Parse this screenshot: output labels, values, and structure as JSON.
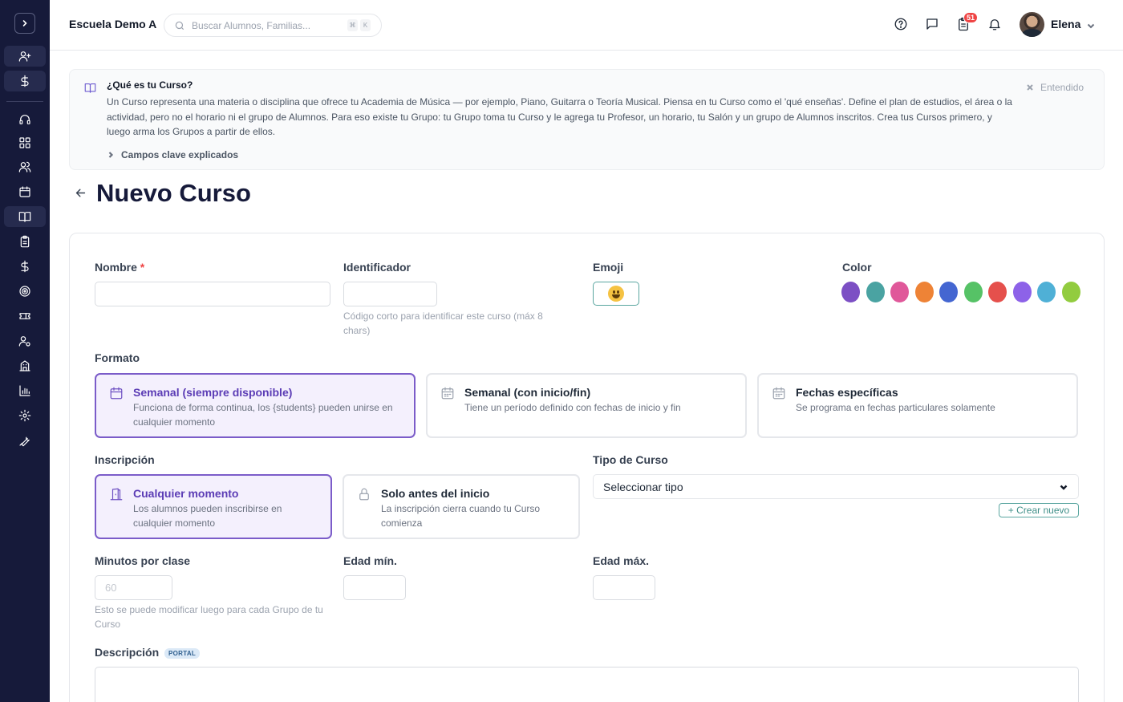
{
  "topbar": {
    "school_name": "Escuela Demo A",
    "search_placeholder": "Buscar Alumnos, Familias...",
    "shortcut_keys": [
      "⌘",
      "K"
    ],
    "notifications_badge": "51",
    "user_name": "Elena"
  },
  "sidebar": {
    "icons": [
      "user-plus-icon",
      "dollar-icon",
      "headset-icon",
      "grid-icon",
      "users-icon",
      "calendar-icon",
      "book-icon",
      "clipboard-icon",
      "dollar-icon",
      "target-icon",
      "ticket-icon",
      "user-gear-icon",
      "building-icon",
      "chart-icon",
      "gear-icon",
      "wrench-icon"
    ]
  },
  "banner": {
    "title": "¿Qué es tu Curso?",
    "text": "Un Curso representa una materia o disciplina que ofrece tu Academia de Música — por ejemplo, Piano, Guitarra o Teoría Musical. Piensa en tu Curso como el 'qué enseñas'. Define el plan de estudios, el área o la actividad, pero no el horario ni el grupo de Alumnos. Para eso existe tu Grupo: tu Grupo toma tu Curso y le agrega tu Profesor, un horario, tu Salón y un grupo de Alumnos inscritos. Crea tus Cursos primero, y luego arma los Grupos a partir de ellos.",
    "expand_label": "Campos clave explicados",
    "dismiss_label": "Entendido"
  },
  "page": {
    "title": "Nuevo Curso"
  },
  "form": {
    "name": {
      "label": "Nombre",
      "required_mark": "*"
    },
    "identifier": {
      "label": "Identificador",
      "hint": "Código corto para identificar este curso (máx 8 chars)"
    },
    "emoji": {
      "label": "Emoji",
      "value": "grinning-face-emoji"
    },
    "color": {
      "label": "Color",
      "options": [
        "#7c4fc4",
        "#4aa3a2",
        "#e0589a",
        "#ee8336",
        "#4466d1",
        "#56c266",
        "#e5504c",
        "#8d62e8",
        "#4fb0d6",
        "#92cc3f"
      ]
    },
    "format": {
      "label": "Formato",
      "options": [
        {
          "title": "Semanal (siempre disponible)",
          "desc": "Funciona de forma continua, los {students} pueden unirse en cualquier momento",
          "selected": true
        },
        {
          "title": "Semanal (con inicio/fin)",
          "desc": "Tiene un período definido con fechas de inicio y fin",
          "selected": false
        },
        {
          "title": "Fechas específicas",
          "desc": "Se programa en fechas particulares solamente",
          "selected": false
        }
      ]
    },
    "enrollment": {
      "label": "Inscripción",
      "options": [
        {
          "title": "Cualquier momento",
          "desc": "Los alumnos pueden inscribirse en cualquier momento",
          "selected": true
        },
        {
          "title": "Solo antes del inicio",
          "desc": "La inscripción cierra cuando tu Curso comienza",
          "selected": false
        }
      ]
    },
    "course_type": {
      "label": "Tipo de Curso",
      "value": "Seleccionar tipo",
      "create_label": "+ Crear nuevo"
    },
    "minutes": {
      "label": "Minutos por clase",
      "placeholder": "60",
      "hint": "Esto se puede modificar luego para cada Grupo de tu Curso"
    },
    "min_age": {
      "label": "Edad mín."
    },
    "max_age": {
      "label": "Edad máx."
    },
    "description": {
      "label": "Descripción",
      "badge": "PORTAL"
    }
  }
}
